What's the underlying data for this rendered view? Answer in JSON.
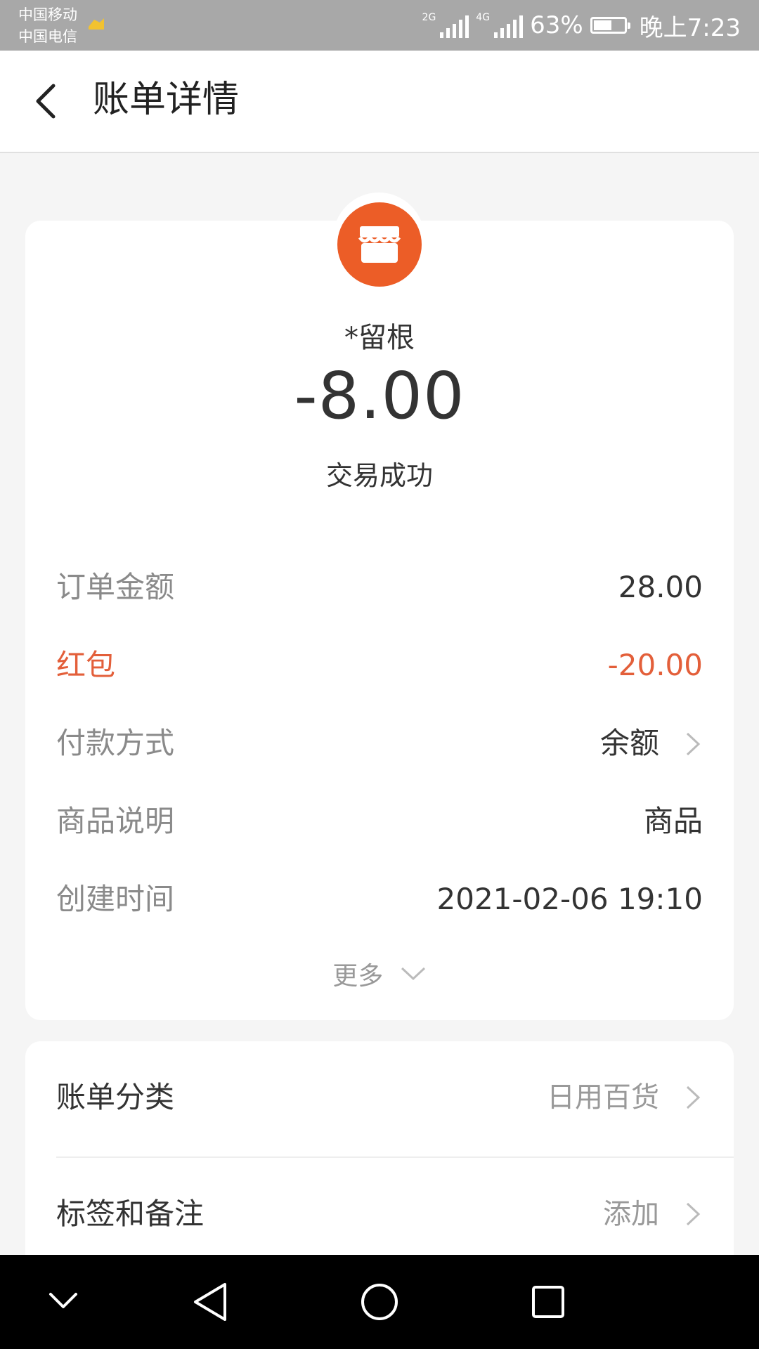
{
  "status_bar": {
    "carrier_1": "中国移动",
    "carrier_2": "中国电信",
    "network_1": "2G",
    "network_2": "4G",
    "battery_percent": "63%",
    "battery_level": 0.63,
    "time": "晚上7:23"
  },
  "header": {
    "back_icon": "chevron-left-icon",
    "title": "账单详情"
  },
  "merchant": {
    "icon": "store-icon",
    "icon_color": "#ec5d27",
    "name": "*留根",
    "amount": "-8.00",
    "status": "交易成功"
  },
  "details": [
    {
      "label": "订单金额",
      "value": "28.00"
    },
    {
      "label": "红包",
      "value": "-20.00",
      "color": "#e35f3a"
    },
    {
      "label": "付款方式",
      "value": "余额"
    },
    {
      "label": "商品说明",
      "value": "商品"
    },
    {
      "label": "创建时间",
      "value": "2021-02-06 19:10"
    }
  ],
  "more": {
    "label": "更多"
  },
  "settings": [
    {
      "label": "账单分类",
      "value": "日用百货"
    },
    {
      "label": "标签和备注",
      "value": "添加"
    }
  ],
  "nav_bar": {
    "icons": [
      "chevron-down-icon",
      "back-triangle-icon",
      "home-circle-icon",
      "recents-square-icon"
    ]
  }
}
